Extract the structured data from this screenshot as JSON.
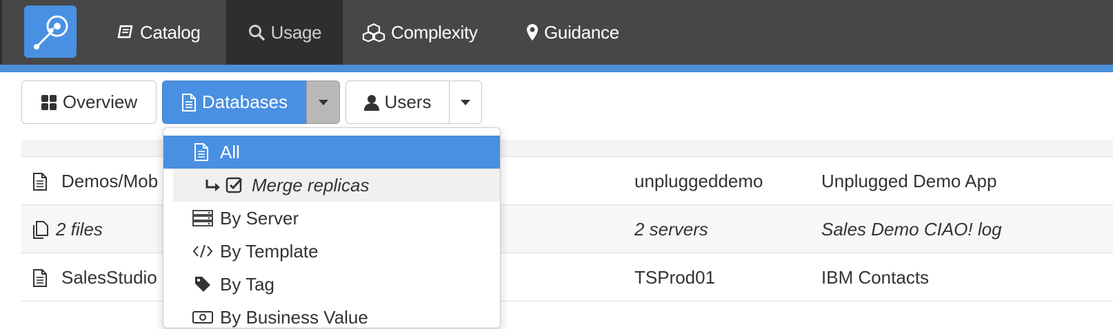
{
  "nav": {
    "items": [
      {
        "label": "Catalog",
        "icon": "book-icon"
      },
      {
        "label": "Usage",
        "icon": "search-icon"
      },
      {
        "label": "Complexity",
        "icon": "cubes-icon"
      },
      {
        "label": "Guidance",
        "icon": "map-marker-icon"
      }
    ],
    "active": "Usage"
  },
  "toolbar": {
    "overview_label": "Overview",
    "databases_label": "Databases",
    "users_label": "Users"
  },
  "dropdown": {
    "items": [
      {
        "label": "All",
        "icon": "file-icon",
        "selected": true
      },
      {
        "label": "Merge replicas",
        "icon": "checkbox-checked-icon",
        "sub": true
      },
      {
        "label": "By Server",
        "icon": "server-icon"
      },
      {
        "label": "By Template",
        "icon": "code-icon"
      },
      {
        "label": "By Tag",
        "icon": "tag-icon"
      },
      {
        "label": "By Business Value",
        "icon": "money-icon"
      }
    ]
  },
  "table": {
    "rows": [
      {
        "name": "Demos/Mob",
        "server": "unpluggeddemo",
        "title": "Unplugged Demo App",
        "italic": false
      },
      {
        "name": "2 files",
        "server": "2 servers",
        "title": "Sales Demo CIAO! log",
        "italic": true
      },
      {
        "name": "SalesStudio",
        "server": "TSProd01",
        "title": "IBM Contacts",
        "italic": false
      }
    ]
  },
  "colors": {
    "topbar": "#474747",
    "accent": "#4a90e2"
  }
}
